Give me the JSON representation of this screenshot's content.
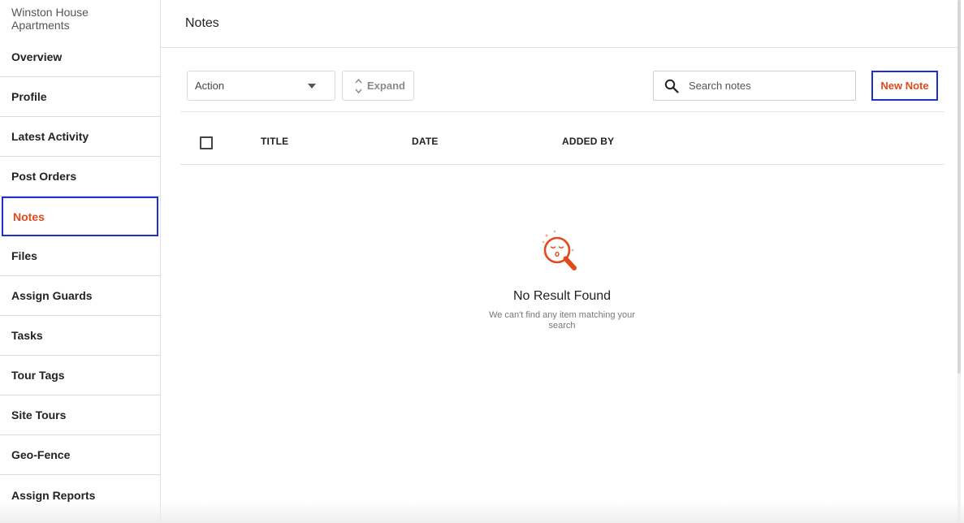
{
  "sidebar": {
    "site_name": "Winston House Apartments",
    "items": [
      {
        "label": "Overview"
      },
      {
        "label": "Profile"
      },
      {
        "label": "Latest Activity"
      },
      {
        "label": "Post Orders"
      },
      {
        "label": "Notes",
        "active": true
      },
      {
        "label": "Files"
      },
      {
        "label": "Assign Guards"
      },
      {
        "label": "Tasks"
      },
      {
        "label": "Tour Tags"
      },
      {
        "label": "Site Tours"
      },
      {
        "label": "Geo-Fence"
      },
      {
        "label": "Assign Reports"
      }
    ]
  },
  "header": {
    "title": "Notes"
  },
  "toolbar": {
    "action_label": "Action",
    "expand_label": "Expand",
    "search_placeholder": "Search notes",
    "new_note_label": "New Note"
  },
  "table": {
    "columns": [
      "TITLE",
      "DATE",
      "ADDED BY"
    ]
  },
  "empty_state": {
    "title": "No Result Found",
    "message": "We can't find any item matching your search"
  },
  "colors": {
    "accent": "#e04a1c",
    "highlight_border": "#1f2fd1"
  },
  "icons": {
    "search": "search-icon",
    "expand": "expand-arrows-icon",
    "dropdown": "caret-down-icon",
    "empty": "no-result-magnifier-icon"
  }
}
